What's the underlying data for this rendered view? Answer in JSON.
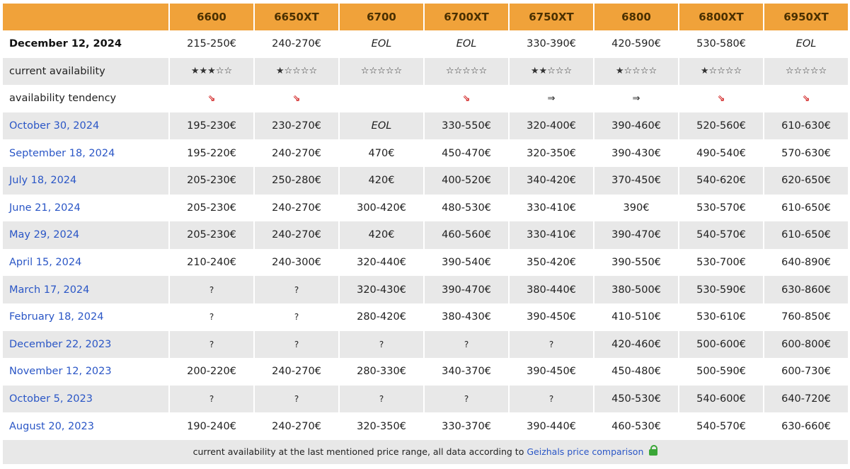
{
  "headers": [
    "6600",
    "6650XT",
    "6700",
    "6700XT",
    "6750XT",
    "6800",
    "6800XT",
    "6950XT"
  ],
  "rows": [
    {
      "type": "bold",
      "label": "December 12, 2024",
      "cells": [
        "215-250€",
        "240-270€",
        "EOL",
        "EOL",
        "330-390€",
        "420-590€",
        "530-580€",
        "EOL"
      ]
    },
    {
      "type": "stars",
      "label": "current availability",
      "cells": [
        "★★★☆☆",
        "★☆☆☆☆",
        "☆☆☆☆☆",
        "☆☆☆☆☆",
        "★★☆☆☆",
        "★☆☆☆☆",
        "★☆☆☆☆",
        "☆☆☆☆☆"
      ]
    },
    {
      "type": "tendency",
      "label": "availability tendency",
      "cells": [
        "⇘",
        "⇘",
        "",
        "⇘",
        "⇒",
        "⇒",
        "⇘",
        "⇘"
      ]
    },
    {
      "type": "date",
      "label": "October 30, 2024",
      "cells": [
        "195-230€",
        "230-270€",
        "EOL",
        "330-550€",
        "320-400€",
        "390-460€",
        "520-560€",
        "610-630€"
      ]
    },
    {
      "type": "date",
      "label": "September 18, 2024",
      "cells": [
        "195-220€",
        "240-270€",
        "470€",
        "450-470€",
        "320-350€",
        "390-430€",
        "490-540€",
        "570-630€"
      ]
    },
    {
      "type": "date",
      "label": "July 18, 2024",
      "cells": [
        "205-230€",
        "250-280€",
        "420€",
        "400-520€",
        "340-420€",
        "370-450€",
        "540-620€",
        "620-650€"
      ]
    },
    {
      "type": "date",
      "label": "June 21, 2024",
      "cells": [
        "205-230€",
        "240-270€",
        "300-420€",
        "480-530€",
        "330-410€",
        "390€",
        "530-570€",
        "610-650€"
      ]
    },
    {
      "type": "date",
      "label": "May 29, 2024",
      "cells": [
        "205-230€",
        "240-270€",
        "420€",
        "460-560€",
        "330-410€",
        "390-470€",
        "540-570€",
        "610-650€"
      ]
    },
    {
      "type": "date",
      "label": "April 15, 2024",
      "cells": [
        "210-240€",
        "240-300€",
        "320-440€",
        "390-540€",
        "350-420€",
        "390-550€",
        "530-700€",
        "640-890€"
      ]
    },
    {
      "type": "date",
      "label": "March 17, 2024",
      "cells": [
        "?",
        "?",
        "320-430€",
        "390-470€",
        "380-440€",
        "380-500€",
        "530-590€",
        "630-860€"
      ]
    },
    {
      "type": "date",
      "label": "February 18, 2024",
      "cells": [
        "?",
        "?",
        "280-420€",
        "380-430€",
        "390-450€",
        "410-510€",
        "530-610€",
        "760-850€"
      ]
    },
    {
      "type": "date",
      "label": "December 22, 2023",
      "cells": [
        "?",
        "?",
        "?",
        "?",
        "?",
        "420-460€",
        "500-600€",
        "600-800€"
      ]
    },
    {
      "type": "date",
      "label": "November 12, 2023",
      "cells": [
        "200-220€",
        "240-270€",
        "280-330€",
        "340-370€",
        "390-450€",
        "450-480€",
        "500-590€",
        "600-730€"
      ]
    },
    {
      "type": "date",
      "label": "October 5, 2023",
      "cells": [
        "?",
        "?",
        "?",
        "?",
        "?",
        "450-530€",
        "540-600€",
        "640-720€"
      ]
    },
    {
      "type": "date",
      "label": "August 20, 2023",
      "cells": [
        "190-240€",
        "240-270€",
        "320-350€",
        "330-370€",
        "390-440€",
        "460-530€",
        "540-570€",
        "630-660€"
      ]
    }
  ],
  "footer": {
    "text": "current availability at the last mentioned price range, all data according to",
    "link": "Geizhals price comparison",
    "icon": "lock-icon",
    "icon_color": "#3aa637"
  },
  "colors": {
    "header_bg": "#f0a23a",
    "stripe_bg": "#e8e8e8",
    "date_link": "#2a56c6",
    "down_arrow": "#d11f1f"
  }
}
